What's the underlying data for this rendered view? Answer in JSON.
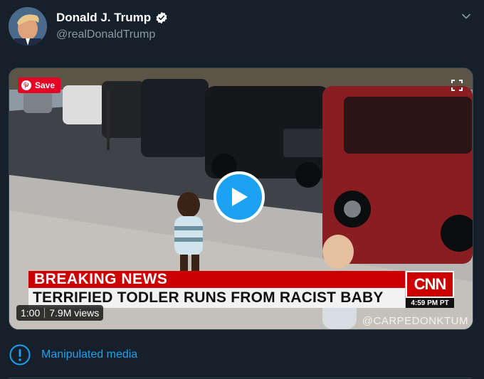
{
  "author": {
    "name": "Donald J. Trump",
    "handle": "@realDonaldTrump",
    "verified_icon": "verified-badge-icon"
  },
  "media": {
    "save_label": "Save",
    "breaking_label": "BREAKING NEWS",
    "headline": "TERRIFIED TODLER RUNS FROM RACIST BABY",
    "network": "CNN",
    "timestamp": "4:59 PM PT",
    "watermark": "@CARPEDONKTUM",
    "duration": "1:00",
    "views": "7.9M views"
  },
  "notice": {
    "label": "Manipulated media"
  },
  "colors": {
    "background": "#15202b",
    "accent": "#1da1f2",
    "muted": "#8899a6",
    "pinterest": "#e60023",
    "cnn_red": "#cc0000"
  }
}
